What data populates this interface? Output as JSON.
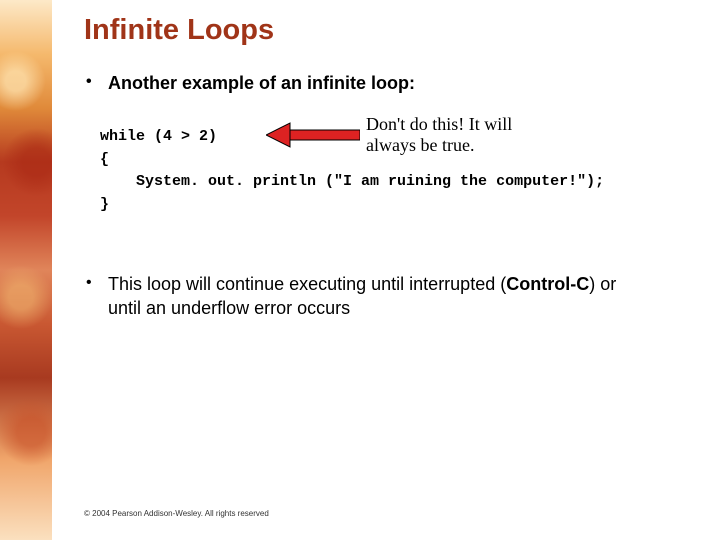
{
  "title": "Infinite Loops",
  "bullet1": "Another example of an infinite loop:",
  "code": {
    "l1": "while (4 > 2)",
    "l2": "{",
    "l3": "    System. out. println (\"I am ruining the computer!\");",
    "l4": "}"
  },
  "annotation": {
    "line1": "Don't do this! It will",
    "line2": "always be true."
  },
  "bullet2": {
    "pre": "This loop will continue executing until interrupted (",
    "ctrl": "Control-C",
    "post": ") or until an underflow error occurs"
  },
  "copyright": "© 2004 Pearson Addison-Wesley. All rights reserved"
}
